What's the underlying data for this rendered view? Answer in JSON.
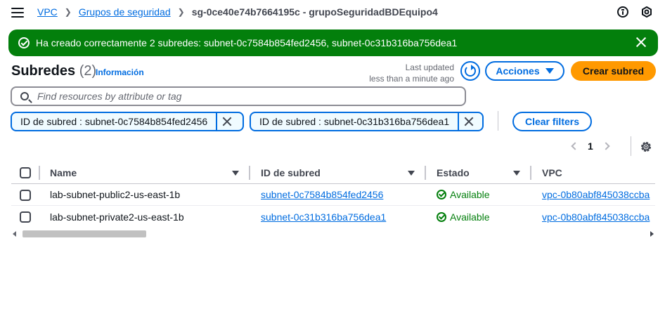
{
  "breadcrumb": {
    "items": [
      {
        "label": "VPC"
      },
      {
        "label": "Grupos de seguridad"
      },
      {
        "label": "sg-0ce40e74b7664195c - grupoSeguridadBDEquipo4"
      }
    ]
  },
  "top_icons": [
    "info-icon",
    "settings-hex-icon"
  ],
  "flash": {
    "message": "Ha creado correctamente 2 subredes: subnet-0c7584b854fed2456, subnet-0c31b316ba756dea1",
    "type": "success",
    "color": "#037f0c"
  },
  "header": {
    "title": "Subredes",
    "count": "(2)",
    "info_link": "Información",
    "updated_label": "Last updated",
    "updated_value": "less than a minute ago",
    "actions_label": "Acciones",
    "create_label": "Crear subred"
  },
  "search": {
    "placeholder": "Find resources by attribute or tag",
    "value": ""
  },
  "filters": {
    "tokens": [
      {
        "label": "ID de subred : subnet-0c7584b854fed2456"
      },
      {
        "label": "ID de subred : subnet-0c31b316ba756dea1"
      }
    ],
    "clear_label": "Clear filters"
  },
  "pagination": {
    "current_page": "1"
  },
  "table": {
    "columns": [
      {
        "label": "Name"
      },
      {
        "label": "ID de subred"
      },
      {
        "label": "Estado"
      },
      {
        "label": "VPC"
      }
    ],
    "rows": [
      {
        "name": "lab-subnet-public2-us-east-1b",
        "subnet_id": "subnet-0c7584b854fed2456",
        "status": "Available",
        "vpc": "vpc-0b80abf845038ccba"
      },
      {
        "name": "lab-subnet-private2-us-east-1b",
        "subnet_id": "subnet-0c31b316ba756dea1",
        "status": "Available",
        "vpc": "vpc-0b80abf845038ccba"
      }
    ]
  },
  "colors": {
    "accent": "#006ce0",
    "primary_button": "#ff9900",
    "success": "#037f0c"
  }
}
